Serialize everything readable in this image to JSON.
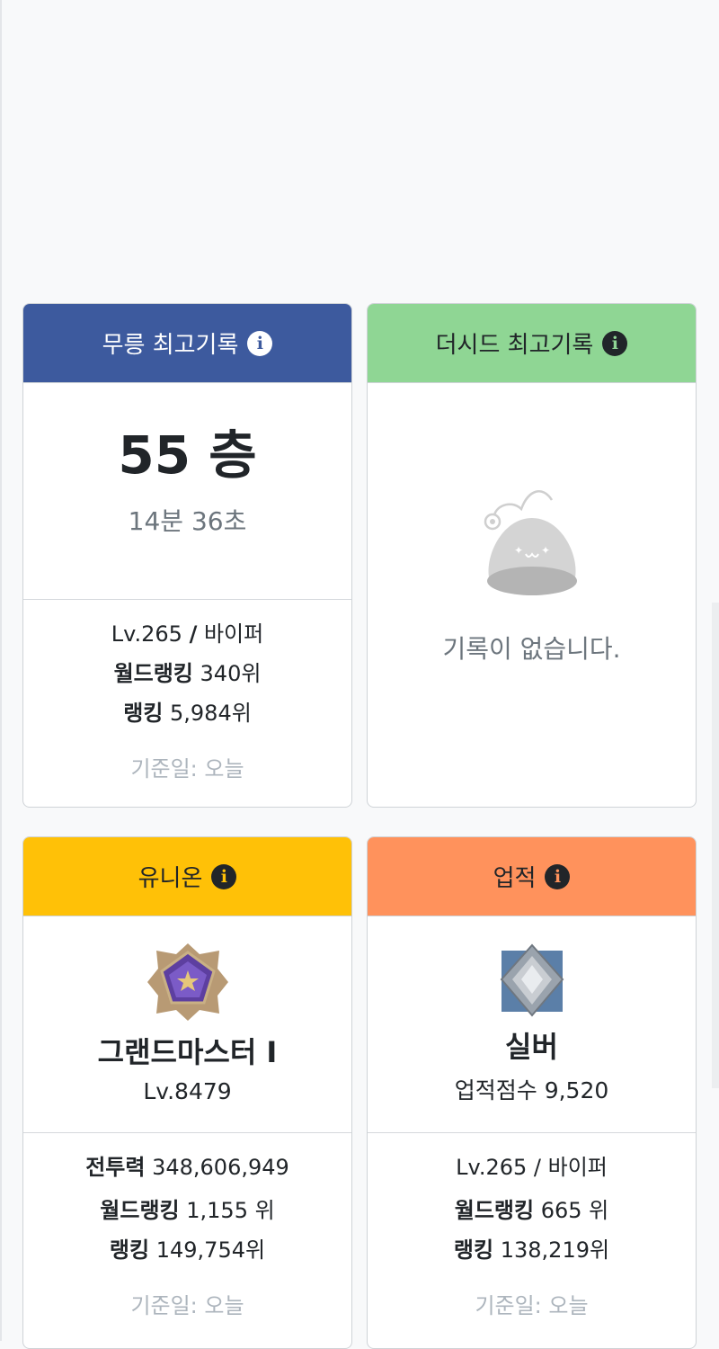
{
  "cards": {
    "mureung": {
      "header": "무릉 최고기록",
      "header_color": "#3d5a9e",
      "floor": "55 층",
      "time": "14분 36초",
      "level": "Lv.265",
      "separator": "/",
      "job": "바이퍼",
      "world_rank_label": "월드랭킹",
      "world_rank_value": "340위",
      "rank_label": "랭킹",
      "rank_value": "5,984위",
      "date": "기준일: 오늘"
    },
    "theseed": {
      "header": "더시드 최고기록",
      "header_color": "#8fd694",
      "empty_text": "기록이 없습니다.",
      "empty_icon": "slime-icon"
    },
    "union": {
      "header": "유니온",
      "header_color": "#ffc107",
      "grade": "그랜드마스터 I",
      "level": "Lv.8479",
      "power_label": "전투력",
      "power_value": "348,606,949",
      "world_rank_label": "월드랭킹",
      "world_rank_value": "1,155 위",
      "rank_label": "랭킹",
      "rank_value": "149,754위",
      "date": "기준일: 오늘",
      "emblem": "grandmaster-emblem-icon"
    },
    "achievement": {
      "header": "업적",
      "header_color": "#ff925c",
      "grade": "실버",
      "score_label": "업적점수",
      "score_value": "9,520",
      "level_job": "Lv.265 / 바이퍼",
      "world_rank_label": "월드랭킹",
      "world_rank_value": "665 위",
      "rank_label": "랭킹",
      "rank_value": "138,219위",
      "date": "기준일: 오늘",
      "emblem": "silver-emblem-icon"
    }
  }
}
